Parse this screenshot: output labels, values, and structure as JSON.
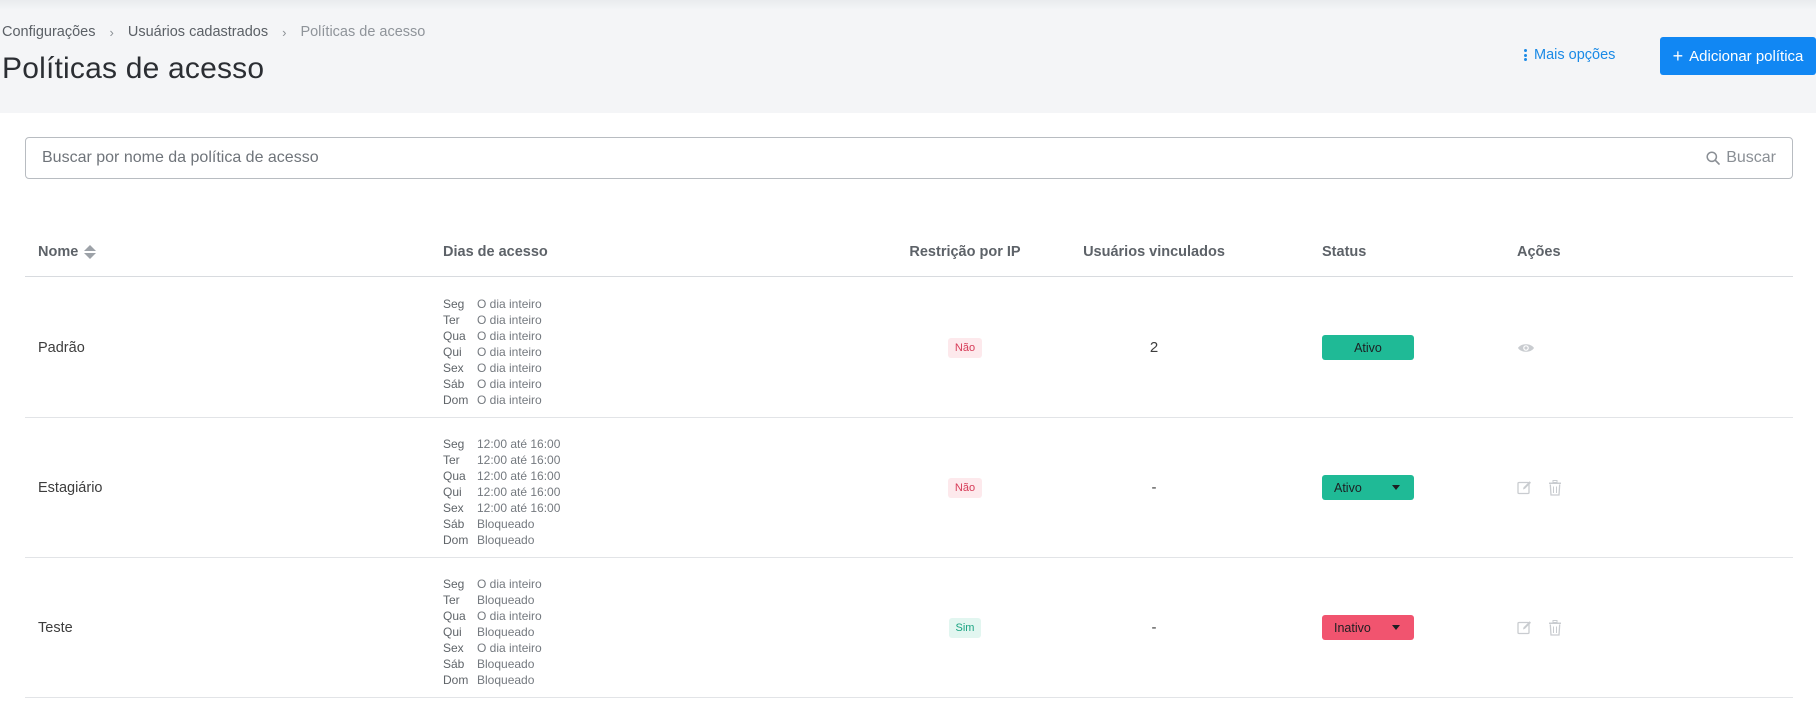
{
  "breadcrumb": {
    "items": [
      "Configurações",
      "Usuários cadastrados"
    ],
    "current": "Políticas de acesso"
  },
  "page": {
    "title": "Políticas de acesso",
    "more_options": "Mais opções",
    "add_button": "Adicionar política"
  },
  "search": {
    "placeholder": "Buscar por nome da política de acesso",
    "value": "",
    "button": "Buscar"
  },
  "table": {
    "headers": {
      "name": "Nome",
      "days": "Dias de acesso",
      "ip": "Restrição por IP",
      "users": "Usuários vinculados",
      "status": "Status",
      "actions": "Ações"
    },
    "rows": [
      {
        "name": "Padrão",
        "days": [
          {
            "day": "Seg",
            "value": "O dia inteiro"
          },
          {
            "day": "Ter",
            "value": "O dia inteiro"
          },
          {
            "day": "Qua",
            "value": "O dia inteiro"
          },
          {
            "day": "Qui",
            "value": "O dia inteiro"
          },
          {
            "day": "Sex",
            "value": "O dia inteiro"
          },
          {
            "day": "Sáb",
            "value": "O dia inteiro"
          },
          {
            "day": "Dom",
            "value": "O dia inteiro"
          }
        ],
        "ip": "Não",
        "users": "2",
        "status": "Ativo"
      },
      {
        "name": "Estagiário",
        "days": [
          {
            "day": "Seg",
            "value": "12:00 até 16:00"
          },
          {
            "day": "Ter",
            "value": "12:00 até 16:00"
          },
          {
            "day": "Qua",
            "value": "12:00 até 16:00"
          },
          {
            "day": "Qui",
            "value": "12:00 até 16:00"
          },
          {
            "day": "Sex",
            "value": "12:00 até 16:00"
          },
          {
            "day": "Sáb",
            "value": "Bloqueado"
          },
          {
            "day": "Dom",
            "value": "Bloqueado"
          }
        ],
        "ip": "Não",
        "users": "-",
        "status": "Ativo"
      },
      {
        "name": "Teste",
        "days": [
          {
            "day": "Seg",
            "value": "O dia inteiro"
          },
          {
            "day": "Ter",
            "value": "Bloqueado"
          },
          {
            "day": "Qua",
            "value": "O dia inteiro"
          },
          {
            "day": "Qui",
            "value": "Bloqueado"
          },
          {
            "day": "Sex",
            "value": "O dia inteiro"
          },
          {
            "day": "Sáb",
            "value": "Bloqueado"
          },
          {
            "day": "Dom",
            "value": "Bloqueado"
          }
        ],
        "ip": "Sim",
        "users": "-",
        "status": "Inativo"
      }
    ]
  },
  "icons": {
    "more": "vertical-dots-icon",
    "add": "plus-icon",
    "search": "search-icon",
    "sort": "sort-icon",
    "view": "eye-icon",
    "edit": "edit-icon",
    "delete": "trash-icon",
    "dropdown": "caret-down-icon"
  },
  "colors": {
    "primary": "#1187f3",
    "link": "#1a8ae6",
    "active": "#1fba96",
    "inactive": "#f1546f",
    "pill_no_bg": "#fde9ec",
    "pill_no_text": "#d63b57",
    "pill_yes_bg": "#e2f6f0",
    "pill_yes_text": "#1aa482"
  }
}
